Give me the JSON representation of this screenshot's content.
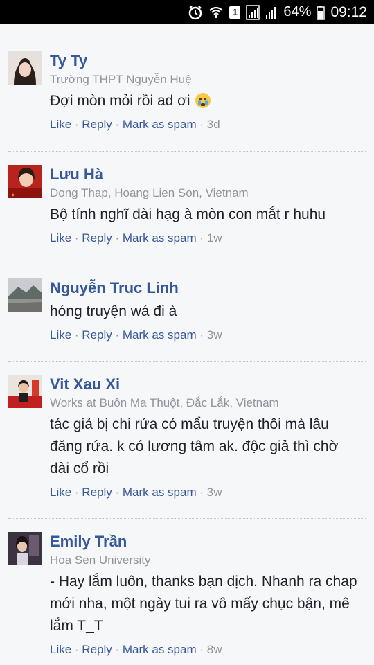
{
  "status_bar": {
    "battery": "64%",
    "time": "09:12",
    "sim_slot": "1"
  },
  "comments": [
    {
      "name": "Ty Ty",
      "meta": "Trường THPT Nguyễn Huệ",
      "text": "Đợi mòn mỏi rồi ad ơi",
      "emoji": "crying-face-emoji",
      "like": "Like",
      "reply": "Reply",
      "spam": "Mark as spam",
      "time": "3d"
    },
    {
      "name": "Lưu Hà",
      "meta": "Dong Thap, Hoang Lien Son, Vietnam",
      "text": "Bộ tính nghĩ dài hạg à mòn con mắt r huhu",
      "like": "Like",
      "reply": "Reply",
      "spam": "Mark as spam",
      "time": "1w"
    },
    {
      "name": "Nguyễn Truc Linh",
      "meta": "",
      "text": "hóng truyện wá đi à",
      "like": "Like",
      "reply": "Reply",
      "spam": "Mark as spam",
      "time": "3w"
    },
    {
      "name": "Vit Xau Xi",
      "meta": "Works at Buôn Ma Thuột, Đắc Lắk, Vietnam",
      "text": "tác giả bị chi rứa có mẩu truyện thôi mà lâu đăng rứa. k có lương tâm ak. độc giả thì chờ dài cổ rồi",
      "like": "Like",
      "reply": "Reply",
      "spam": "Mark as spam",
      "time": "3w"
    },
    {
      "name": "Emily Trần",
      "meta": "Hoa Sen University",
      "text": "- Hay lắm luôn, thanks bạn dịch. Nhanh ra chap mới nha, một ngày tui ra vô mấy chục bận, mê lắm T_T",
      "like": "Like",
      "reply": "Reply",
      "spam": "Mark as spam",
      "time": "8w"
    }
  ],
  "separator": " · ",
  "colors": {
    "name": "#365899",
    "meta": "#90949c",
    "text": "#1d2129",
    "background": "#f6f7f9"
  }
}
